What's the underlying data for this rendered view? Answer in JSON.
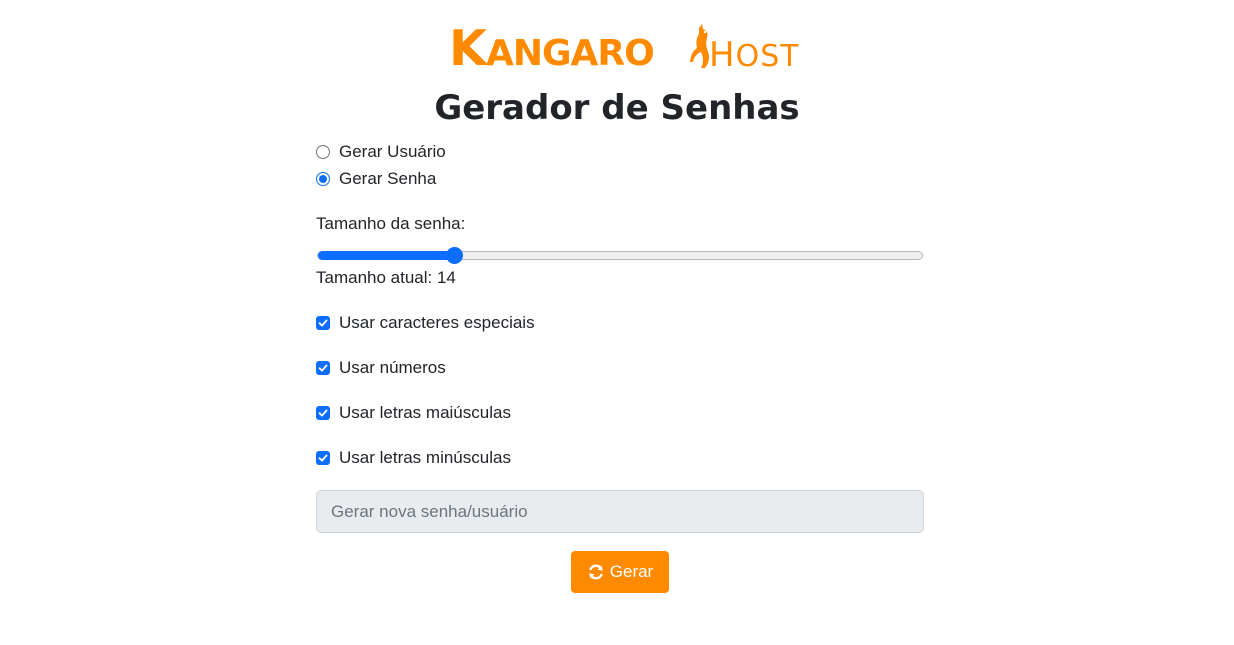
{
  "brand": {
    "main_first": "K",
    "main_rest": "ANGARO",
    "host_first": "H",
    "host_rest": "OST",
    "color": "#ff8a00"
  },
  "title": "Gerador de Senhas",
  "mode": {
    "options": [
      {
        "label": "Gerar Usuário",
        "checked": false
      },
      {
        "label": "Gerar Senha",
        "checked": true
      }
    ]
  },
  "length": {
    "label": "Tamanho da senha:",
    "current_label": "Tamanho atual: 14",
    "fraction": 0.225
  },
  "options": [
    {
      "label": "Usar caracteres especiais",
      "checked": true
    },
    {
      "label": "Usar números",
      "checked": true
    },
    {
      "label": "Usar letras maiúsculas",
      "checked": true
    },
    {
      "label": "Usar letras minúsculas",
      "checked": true
    }
  ],
  "output": {
    "placeholder": "Gerar nova senha/usuário"
  },
  "button": {
    "label": "Gerar",
    "icon": "refresh-icon"
  },
  "colors": {
    "accent": "#0d6efd",
    "brand": "#ff8a00"
  }
}
